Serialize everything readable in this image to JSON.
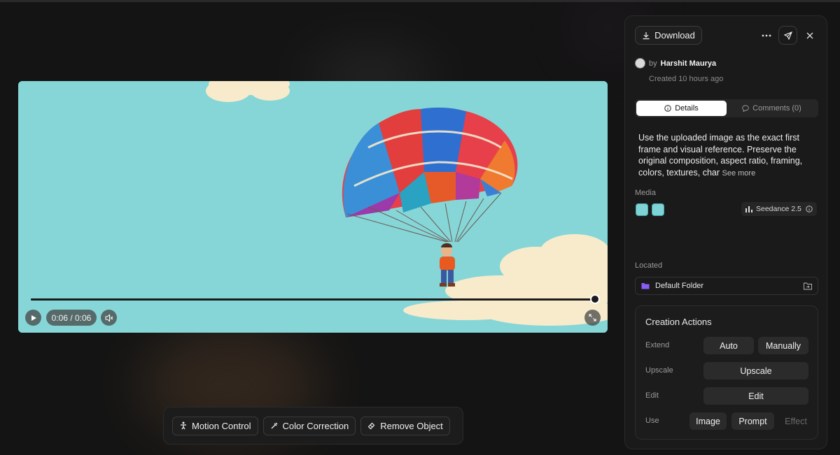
{
  "video": {
    "time": "0:06 / 0:06",
    "progress": 1.0
  },
  "toolbar": {
    "motion_control": "Motion Control",
    "color_correction": "Color Correction",
    "remove_object": "Remove Object"
  },
  "panel": {
    "download_label": "Download",
    "by_label": "by",
    "author": "Harshit Maurya",
    "created": "Created 10 hours ago",
    "tabs": [
      {
        "label": "Details",
        "active": true
      },
      {
        "label": "Comments (0)",
        "active": false
      }
    ],
    "description": "Use the uploaded image as the exact first frame and visual reference. Preserve the original composition, aspect ratio, framing, colors, textures, char",
    "see_more": "See more",
    "media_label": "Media",
    "model": "Seedance 2.5",
    "located_label": "Located",
    "folder": "Default Folder",
    "actions": {
      "title": "Creation Actions",
      "extend_label": "Extend",
      "extend_auto": "Auto",
      "extend_manual": "Manually",
      "upscale_label": "Upscale",
      "upscale_btn": "Upscale",
      "edit_label": "Edit",
      "edit_btn": "Edit",
      "use_label": "Use",
      "use_image": "Image",
      "use_prompt": "Prompt",
      "use_effect": "Effect"
    }
  },
  "colors": {
    "sky": "#86d6d8",
    "panel_bg": "#1a1a1a",
    "folder_icon": "#8a5cf6"
  }
}
